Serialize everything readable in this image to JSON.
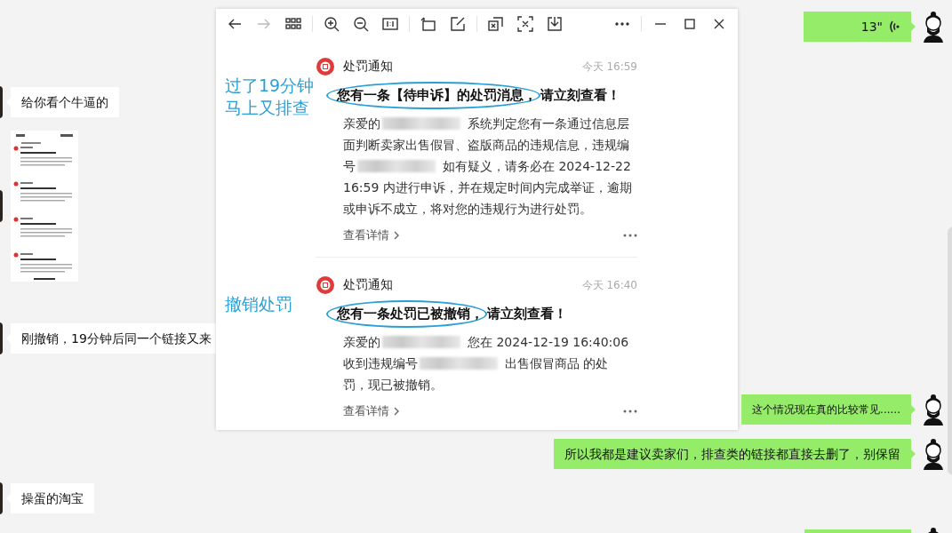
{
  "chat": {
    "messages": [
      {
        "outgoing": true,
        "kind": "voice",
        "duration": "13\""
      },
      {
        "outgoing": false,
        "kind": "text",
        "text": "给你看个牛逼的"
      },
      {
        "outgoing": false,
        "kind": "image"
      },
      {
        "outgoing": false,
        "kind": "text",
        "text": "刚撤销，19分钟后同一个链接又来"
      },
      {
        "outgoing": true,
        "kind": "text",
        "text": "这个情况现在真的比较常见......"
      },
      {
        "outgoing": true,
        "kind": "text",
        "text": "所以我都是建议卖家们，排查类的链接都直接去删了，别保留"
      },
      {
        "outgoing": false,
        "kind": "text",
        "text": "操蛋的淘宝"
      },
      {
        "outgoing": true,
        "kind": "cut"
      }
    ]
  },
  "viewer": {
    "toolbar_groups": [
      [
        {
          "kind": "back",
          "disabled": false
        },
        {
          "kind": "forward",
          "disabled": true
        },
        {
          "kind": "grid",
          "disabled": false
        }
      ],
      [
        {
          "kind": "zoom-in",
          "disabled": false
        },
        {
          "kind": "zoom-out",
          "disabled": false
        },
        {
          "kind": "actual-size",
          "disabled": false
        }
      ],
      [
        {
          "kind": "rotate",
          "disabled": false
        },
        {
          "kind": "edit",
          "disabled": false
        }
      ],
      [
        {
          "kind": "translate",
          "disabled": false
        },
        {
          "kind": "scan",
          "disabled": false
        },
        {
          "kind": "download",
          "disabled": false
        }
      ],
      [
        {
          "kind": "more",
          "disabled": false
        }
      ],
      [
        {
          "kind": "minimize",
          "disabled": false
        },
        {
          "kind": "maximize",
          "disabled": false
        },
        {
          "kind": "close",
          "disabled": false
        }
      ]
    ],
    "notifications": [
      {
        "title": "处罚通知",
        "time": "今天 16:59",
        "note_lines": [
          "过了19分钟",
          "马上又排查"
        ],
        "headline_circled": "您有一条【待申诉】的处罚消息，",
        "headline_rest": "请立刻查看！",
        "body_lines": [
          [
            {
              "kind": "text",
              "text": "亲爱的"
            },
            {
              "kind": "redacted"
            },
            {
              "kind": "text",
              "text": "系统判定您有一条通过信息层"
            }
          ],
          [
            {
              "kind": "text",
              "text": "面判断卖家出售假冒、盗版商品的违规信息，违规编"
            }
          ],
          [
            {
              "kind": "text",
              "text": "号"
            },
            {
              "kind": "redacted"
            },
            {
              "kind": "text",
              "text": "如有疑义，请务必在 2024-12-22"
            }
          ],
          [
            {
              "kind": "text",
              "text": "16:59 内进行申诉，并在规定时间内完成举证，逾期"
            }
          ],
          [
            {
              "kind": "text",
              "text": "或申诉不成立，将对您的违规行为进行处罚。"
            }
          ]
        ],
        "link": "查看详情"
      },
      {
        "title": "处罚通知",
        "time": "今天 16:40",
        "note_lines": [
          "撤销处罚"
        ],
        "headline_circled": "您有一条处罚已被撤销，",
        "headline_rest": "请立刻查看！",
        "body_lines": [
          [
            {
              "kind": "text",
              "text": "亲爱的"
            },
            {
              "kind": "redacted"
            },
            {
              "kind": "text",
              "text": "您在 2024-12-19 16:40:06"
            }
          ],
          [
            {
              "kind": "text",
              "text": "收到违规编号"
            },
            {
              "kind": "redacted"
            },
            {
              "kind": "text",
              "text": "出售假冒商品 的处"
            }
          ],
          [
            {
              "kind": "text",
              "text": "罚，现已被撤销。"
            }
          ]
        ],
        "link": "查看详情"
      }
    ]
  }
}
